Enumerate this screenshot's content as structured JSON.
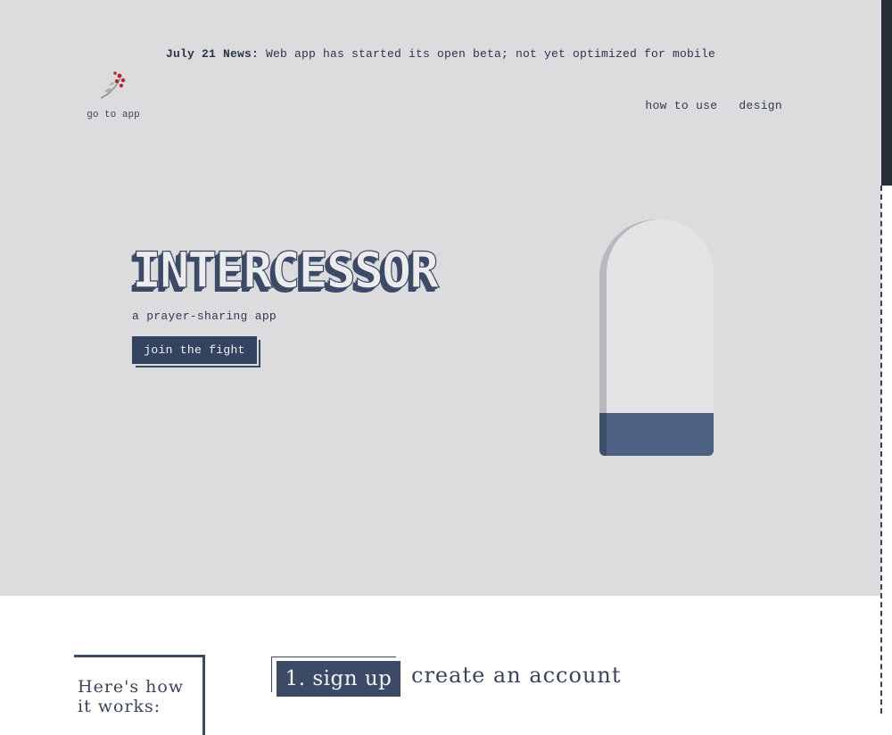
{
  "news": {
    "date": "July 21 News:",
    "text": " Web app has started its open beta; not yet optimized for mobile"
  },
  "logo": {
    "label": "go to app",
    "icon": "branch-logo-icon"
  },
  "nav": [
    {
      "label": "how to use"
    },
    {
      "label": "design"
    }
  ],
  "hero": {
    "title": "INTERCESSOR",
    "subtitle": "a prayer-sharing app",
    "cta_label": "join the fight"
  },
  "how_it_works": {
    "heading": "Here's how it works:",
    "steps": [
      {
        "badge": "1. sign up",
        "description": "create an account"
      }
    ]
  },
  "colors": {
    "hero_bg": "#dcdcde",
    "accent": "#344460",
    "phone_fill": "#4d6182",
    "logo_berries": "#b3262a"
  }
}
